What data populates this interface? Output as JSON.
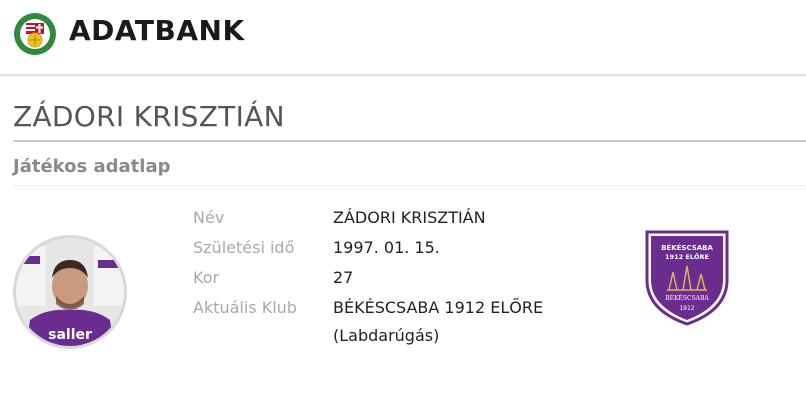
{
  "header": {
    "brand": "ADATBANK",
    "logo_icon": "hungarian-football-federation-crest-icon"
  },
  "page": {
    "title": "ZÁDORI KRISZTIÁN",
    "subtitle": "Játékos adatlap"
  },
  "player": {
    "photo_icon": "player-photo",
    "fields": [
      {
        "label": "Név",
        "value": "ZÁDORI KRISZTIÁN"
      },
      {
        "label": "Születési idő",
        "value": "1997. 01. 15."
      },
      {
        "label": "Kor",
        "value": "27"
      },
      {
        "label": "Aktuális Klub",
        "value": "BÉKÉSCSABA 1912 ELŐRE",
        "value2": "(Labdarúgás)"
      }
    ]
  },
  "club": {
    "logo_icon": "bekescsaba-club-crest-icon",
    "crest_text_top": "BÉKÉSCSABA",
    "crest_text_mid": "1912 ELŐRE",
    "crest_text_low": "BÉKÉSCSABA",
    "crest_year": "1912",
    "color": "#6b2c8f"
  }
}
